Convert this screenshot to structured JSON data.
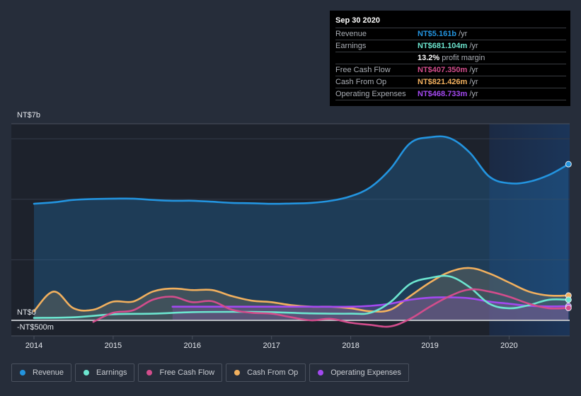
{
  "tooltip": {
    "date": "Sep 30 2020",
    "rows": [
      {
        "label": "Revenue",
        "value": "NT$5.161b",
        "unit": "/yr",
        "color": "#2394df"
      },
      {
        "label": "Earnings",
        "value": "NT$681.104m",
        "unit": "/yr",
        "color": "#6ce5cf"
      },
      {
        "label": "",
        "value": "13.2%",
        "unit": "profit margin",
        "color": "#ffffff"
      },
      {
        "label": "Free Cash Flow",
        "value": "NT$407.350m",
        "unit": "/yr",
        "color": "#d24d8c"
      },
      {
        "label": "Cash From Op",
        "value": "NT$821.426m",
        "unit": "/yr",
        "color": "#f2b05e"
      },
      {
        "label": "Operating Expenses",
        "value": "NT$468.733m",
        "unit": "/yr",
        "color": "#a349f0"
      }
    ]
  },
  "legend": [
    {
      "label": "Revenue",
      "color": "#2394df"
    },
    {
      "label": "Earnings",
      "color": "#6ce5cf"
    },
    {
      "label": "Free Cash Flow",
      "color": "#d24d8c"
    },
    {
      "label": "Cash From Op",
      "color": "#f2b05e"
    },
    {
      "label": "Operating Expenses",
      "color": "#a349f0"
    }
  ],
  "chart_data": {
    "type": "line",
    "title": "",
    "xlabel": "",
    "ylabel": "",
    "unit": "NT$ billions",
    "y_top_label": "NT$7b",
    "y_zero_label": "NT$0",
    "y_neg_label": "-NT$500m",
    "ylim": [
      -0.5,
      6.5
    ],
    "xlim": [
      2013.95,
      2020.75
    ],
    "x_ticks": [
      "2014",
      "2015",
      "2016",
      "2017",
      "2018",
      "2019",
      "2020"
    ],
    "forecast_shade_start": 2019.75,
    "grid": true,
    "legend_position": "bottom",
    "series": [
      {
        "name": "Revenue",
        "color": "#2394df",
        "area": true,
        "x": [
          2014.0,
          2014.25,
          2014.5,
          2014.75,
          2015.0,
          2015.25,
          2015.5,
          2015.75,
          2016.0,
          2016.25,
          2016.5,
          2016.75,
          2017.0,
          2017.25,
          2017.5,
          2017.75,
          2018.0,
          2018.25,
          2018.5,
          2018.75,
          2019.0,
          2019.25,
          2019.5,
          2019.75,
          2020.0,
          2020.25,
          2020.5,
          2020.75
        ],
        "values": [
          3.85,
          3.9,
          3.98,
          4.01,
          4.02,
          4.02,
          3.98,
          3.95,
          3.95,
          3.92,
          3.88,
          3.87,
          3.85,
          3.86,
          3.88,
          3.95,
          4.1,
          4.4,
          5.0,
          5.85,
          6.05,
          6.02,
          5.55,
          4.75,
          4.53,
          4.58,
          4.8,
          5.16
        ]
      },
      {
        "name": "Earnings",
        "color": "#6ce5cf",
        "area": false,
        "x": [
          2014.0,
          2014.5,
          2015.0,
          2015.5,
          2016.0,
          2016.5,
          2017.0,
          2017.5,
          2018.0,
          2018.25,
          2018.5,
          2018.75,
          2019.0,
          2019.25,
          2019.5,
          2019.75,
          2020.0,
          2020.25,
          2020.5,
          2020.75
        ],
        "values": [
          0.08,
          0.1,
          0.2,
          0.22,
          0.27,
          0.28,
          0.27,
          0.23,
          0.22,
          0.25,
          0.6,
          1.2,
          1.4,
          1.45,
          1.1,
          0.55,
          0.4,
          0.5,
          0.68,
          0.68
        ]
      },
      {
        "name": "Free Cash Flow",
        "color": "#d24d8c",
        "area": false,
        "x": [
          2014.75,
          2015.0,
          2015.25,
          2015.5,
          2015.75,
          2016.0,
          2016.25,
          2016.5,
          2016.75,
          2017.0,
          2017.25,
          2017.5,
          2017.75,
          2018.0,
          2018.25,
          2018.5,
          2018.75,
          2019.0,
          2019.25,
          2019.5,
          2019.75,
          2020.0,
          2020.25,
          2020.5,
          2020.75
        ],
        "values": [
          -0.05,
          0.25,
          0.33,
          0.68,
          0.78,
          0.6,
          0.63,
          0.35,
          0.25,
          0.22,
          0.1,
          0.0,
          0.05,
          -0.08,
          -0.15,
          -0.2,
          0.05,
          0.45,
          0.8,
          1.02,
          0.95,
          0.78,
          0.55,
          0.4,
          0.41
        ]
      },
      {
        "name": "Cash From Op",
        "color": "#f2b05e",
        "area": true,
        "x": [
          2014.0,
          2014.25,
          2014.5,
          2014.75,
          2015.0,
          2015.25,
          2015.5,
          2015.75,
          2016.0,
          2016.25,
          2016.5,
          2016.75,
          2017.0,
          2017.25,
          2017.5,
          2017.75,
          2018.0,
          2018.25,
          2018.5,
          2018.75,
          2019.0,
          2019.25,
          2019.5,
          2019.75,
          2020.0,
          2020.25,
          2020.5,
          2020.75
        ],
        "values": [
          0.3,
          0.95,
          0.4,
          0.35,
          0.62,
          0.62,
          0.95,
          1.05,
          1.0,
          1.0,
          0.8,
          0.65,
          0.6,
          0.5,
          0.45,
          0.45,
          0.4,
          0.3,
          0.35,
          0.8,
          1.25,
          1.6,
          1.73,
          1.55,
          1.25,
          0.95,
          0.82,
          0.82
        ]
      },
      {
        "name": "Operating Expenses",
        "color": "#a349f0",
        "area": true,
        "x": [
          2015.75,
          2016.0,
          2016.5,
          2017.0,
          2017.5,
          2018.0,
          2018.25,
          2018.5,
          2018.75,
          2019.0,
          2019.25,
          2019.5,
          2019.75,
          2020.0,
          2020.25,
          2020.5,
          2020.75
        ],
        "values": [
          0.45,
          0.45,
          0.45,
          0.45,
          0.45,
          0.45,
          0.48,
          0.55,
          0.68,
          0.75,
          0.76,
          0.73,
          0.62,
          0.55,
          0.48,
          0.46,
          0.47
        ]
      }
    ]
  }
}
